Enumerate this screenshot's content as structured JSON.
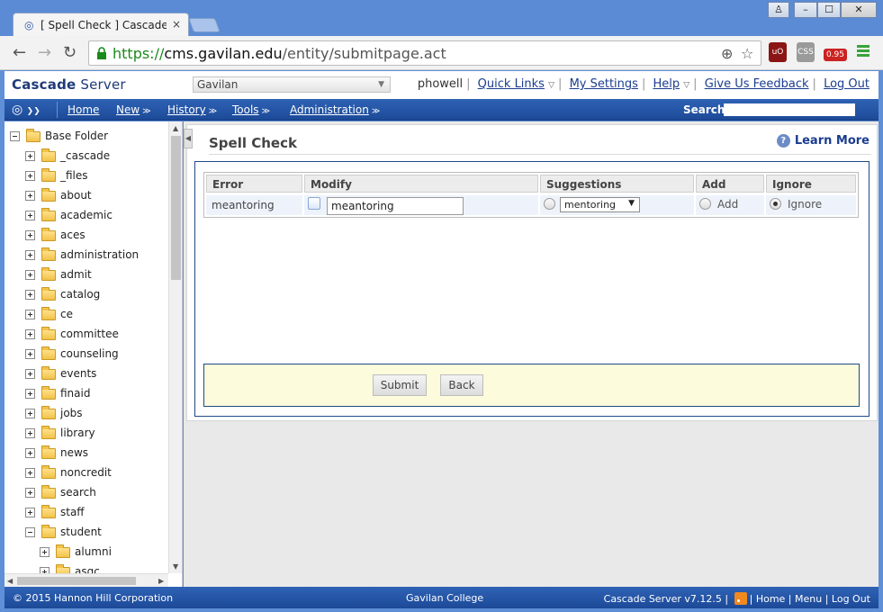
{
  "browser": {
    "tab_title": "[ Spell Check ] Cascade Serv",
    "tab_close": "×",
    "url_scheme": "https://",
    "url_host": "cms.gavilan.edu",
    "url_path": "/entity/submitpage.act",
    "window_buttons": [
      "♙",
      "–",
      "☐",
      "✕"
    ],
    "ext_css": "CSS",
    "ext_badge": "0.95",
    "ext_ublock": "uO"
  },
  "header": {
    "logo_bold": "Cascade",
    "logo_light": " Server",
    "site_select": "Gavilan",
    "user": "phowell",
    "links": {
      "quick_links": "Quick Links",
      "my_settings": "My Settings",
      "help": "Help",
      "feedback": "Give Us Feedback",
      "logout": "Log Out"
    }
  },
  "nav": {
    "items": [
      "Home",
      "New",
      "History",
      "Tools",
      "Administration"
    ],
    "search_label": "Search"
  },
  "tree": {
    "root": "Base Folder",
    "items": [
      "_cascade",
      "_files",
      "about",
      "academic",
      "aces",
      "administration",
      "admit",
      "catalog",
      "ce",
      "committee",
      "counseling",
      "events",
      "finaid",
      "jobs",
      "library",
      "news",
      "noncredit",
      "search",
      "staff",
      "student"
    ],
    "student_children": [
      "alumni",
      "asgc"
    ]
  },
  "main": {
    "title": "Spell Check",
    "learn_more": "Learn More",
    "table": {
      "headers": [
        "Error",
        "Modify",
        "Suggestions",
        "Add",
        "Ignore"
      ],
      "row": {
        "error": "meantoring",
        "modify_value": "meantoring",
        "suggestion": "mentoring",
        "add_label": "Add",
        "ignore_label": "Ignore"
      }
    },
    "submit": "Submit",
    "back": "Back"
  },
  "footer": {
    "copyright": "© 2015 Hannon Hill Corporation",
    "center": "Gavilan College",
    "version": "Cascade Server v7.12.5 |",
    "home": "Home",
    "menu": "Menu",
    "logout": "Log Out"
  }
}
